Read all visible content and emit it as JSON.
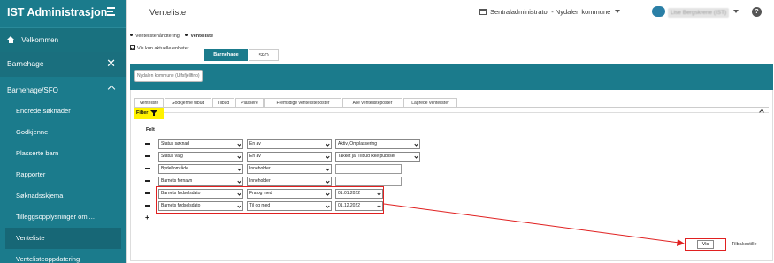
{
  "sidebar": {
    "app_title": "IST Administrasjon",
    "home_label": "Velkommen",
    "section_label": "Barnehage",
    "group_label": "Barnehage/SFO",
    "items": [
      {
        "label": "Endrede søknader"
      },
      {
        "label": "Godkjenne"
      },
      {
        "label": "Plasserte barn"
      },
      {
        "label": "Rapporter"
      },
      {
        "label": "Søknadsskjema"
      },
      {
        "label": "Tilleggsopplysninger om ..."
      },
      {
        "label": "Venteliste"
      },
      {
        "label": "Ventelisteoppdatering"
      }
    ],
    "active_item": "Venteliste"
  },
  "header": {
    "page_title": "Venteliste",
    "role": "Sentraladministrator - Nydalen kommune",
    "user_name": "Lise Bergskrene (IST)",
    "help": "?"
  },
  "breadcrumb": {
    "first": "Ventelistehåndtering",
    "current": "Venteliste"
  },
  "options": {
    "only_current_units": "Vis kun aktuelle enheter",
    "segments": [
      "Barnehage",
      "SFO"
    ]
  },
  "kommune_selector": "Nydalen kommune (Ulfsfjellfino)",
  "tabs": [
    "Venteliste",
    "Godkjenne tilbud",
    "Tilbud",
    "Plassere",
    "Fremtidige ventelisteposter",
    "Alle ventelisteposter",
    "Lagrede ventelister"
  ],
  "filter": {
    "button_label": "Filter",
    "felt_label": "Felt",
    "rows": [
      {
        "field": "Status søknad",
        "op": "En av",
        "value": "Aktiv, Omplassering"
      },
      {
        "field": "Status valg",
        "op": "En av",
        "value": "Takket ja, Tilbud ikke publiser"
      },
      {
        "field": "Bydel/område",
        "op": "Inneholder",
        "value": ""
      },
      {
        "field": "Barnets fornavn",
        "op": "Inneholder",
        "value": ""
      },
      {
        "field": "Barnets fødselsdato",
        "op": "Fra og med",
        "value": "01.01.2022"
      },
      {
        "field": "Barnets fødselsdato",
        "op": "Til og med",
        "value": "01.12.2022"
      }
    ],
    "add_symbol": "+",
    "show_label": "Vis",
    "reset_label": "Tilbakestille"
  },
  "colors": {
    "sidebar": "#1b7b8c",
    "highlight": "#e02020",
    "filter_button": "#fff200"
  }
}
